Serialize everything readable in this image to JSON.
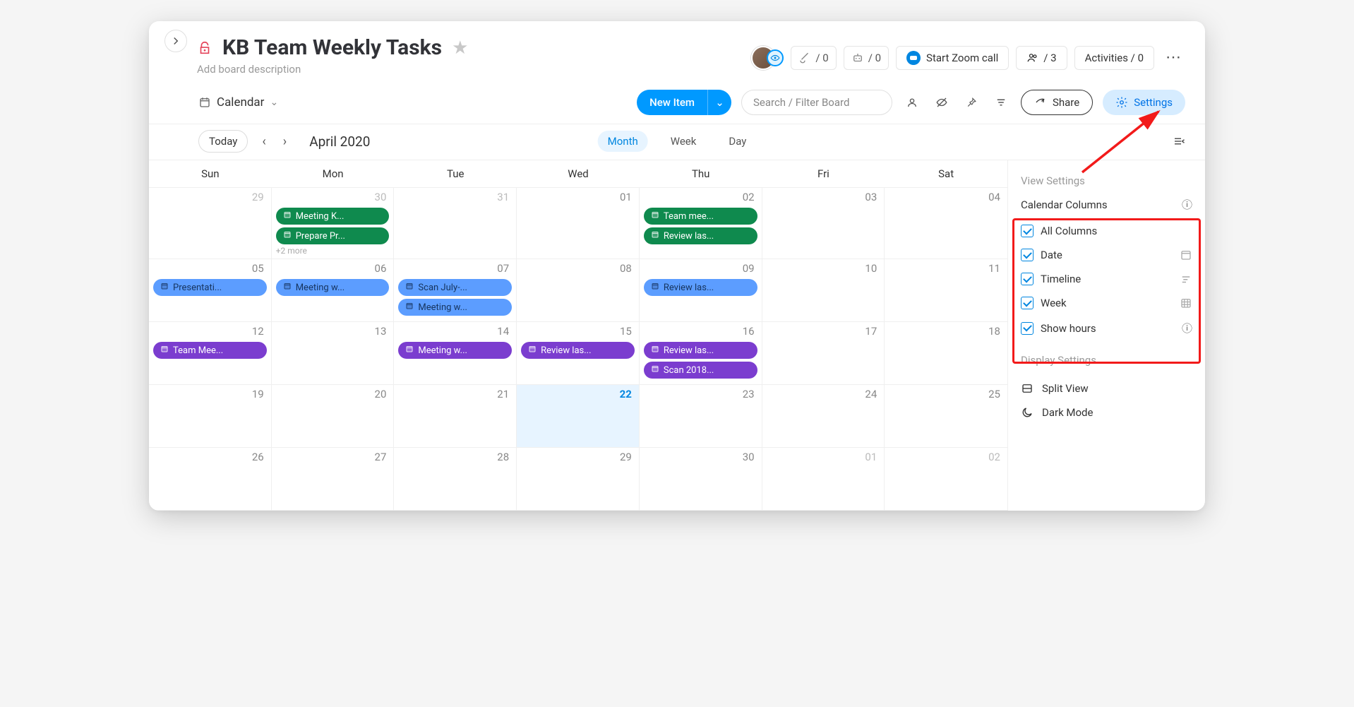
{
  "board": {
    "title": "KB Team Weekly Tasks",
    "description_placeholder": "Add board description"
  },
  "header": {
    "integrations_count": "/ 0",
    "automations_count": "/ 0",
    "zoom_label": "Start Zoom call",
    "members_count": "/ 3",
    "activities_label": "Activities / 0"
  },
  "toolbar": {
    "view_label": "Calendar",
    "new_item_label": "New Item",
    "search_placeholder": "Search / Filter Board",
    "share_label": "Share",
    "settings_label": "Settings"
  },
  "calendar": {
    "today_label": "Today",
    "month_label": "April 2020",
    "view_modes": {
      "month": "Month",
      "week": "Week",
      "day": "Day"
    },
    "dow": [
      "Sun",
      "Mon",
      "Tue",
      "Wed",
      "Thu",
      "Fri",
      "Sat"
    ],
    "weeks": [
      {
        "days": [
          {
            "num": "29",
            "dim": true
          },
          {
            "num": "30",
            "dim": true,
            "events": [
              {
                "label": "Meeting K...",
                "color": "green"
              },
              {
                "label": "Prepare Pr...",
                "color": "green"
              }
            ],
            "more": "+2 more"
          },
          {
            "num": "31",
            "dim": true
          },
          {
            "num": "01"
          },
          {
            "num": "02",
            "events": [
              {
                "label": "Team mee...",
                "color": "green"
              },
              {
                "label": "Review las...",
                "color": "green"
              }
            ]
          },
          {
            "num": "03"
          },
          {
            "num": "04"
          }
        ]
      },
      {
        "days": [
          {
            "num": "05",
            "events": [
              {
                "label": "Presentati...",
                "color": "blue"
              }
            ]
          },
          {
            "num": "06",
            "events": [
              {
                "label": "Meeting w...",
                "color": "blue"
              }
            ]
          },
          {
            "num": "07",
            "events": [
              {
                "label": "Scan July-...",
                "color": "blue"
              },
              {
                "label": "Meeting w...",
                "color": "blue"
              }
            ]
          },
          {
            "num": "08"
          },
          {
            "num": "09",
            "events": [
              {
                "label": "Review las...",
                "color": "blue"
              }
            ]
          },
          {
            "num": "10"
          },
          {
            "num": "11"
          }
        ]
      },
      {
        "days": [
          {
            "num": "12",
            "events": [
              {
                "label": "Team Mee...",
                "color": "purple"
              }
            ]
          },
          {
            "num": "13"
          },
          {
            "num": "14",
            "events": [
              {
                "label": "Meeting w...",
                "color": "purple"
              }
            ]
          },
          {
            "num": "15",
            "events": [
              {
                "label": "Review las...",
                "color": "purple"
              }
            ]
          },
          {
            "num": "16",
            "events": [
              {
                "label": "Review las...",
                "color": "purple"
              },
              {
                "label": "Scan 2018...",
                "color": "purple"
              }
            ]
          },
          {
            "num": "17"
          },
          {
            "num": "18"
          }
        ]
      },
      {
        "days": [
          {
            "num": "19"
          },
          {
            "num": "20"
          },
          {
            "num": "21"
          },
          {
            "num": "22",
            "today": true
          },
          {
            "num": "23"
          },
          {
            "num": "24"
          },
          {
            "num": "25"
          }
        ]
      },
      {
        "days": [
          {
            "num": "26"
          },
          {
            "num": "27"
          },
          {
            "num": "28"
          },
          {
            "num": "29"
          },
          {
            "num": "30"
          },
          {
            "num": "01",
            "dim": true
          },
          {
            "num": "02",
            "dim": true
          }
        ]
      }
    ]
  },
  "settings_panel": {
    "view_settings": "View Settings",
    "calendar_columns": "Calendar Columns",
    "columns": [
      {
        "label": "All Columns",
        "checked": true
      },
      {
        "label": "Date",
        "checked": true,
        "icon": "date"
      },
      {
        "label": "Timeline",
        "checked": true,
        "icon": "timeline"
      },
      {
        "label": "Week",
        "checked": true,
        "icon": "week"
      }
    ],
    "show_hours": {
      "label": "Show hours",
      "checked": true
    },
    "display_settings": "Display Settings",
    "split_view": "Split View",
    "dark_mode": "Dark Mode"
  }
}
